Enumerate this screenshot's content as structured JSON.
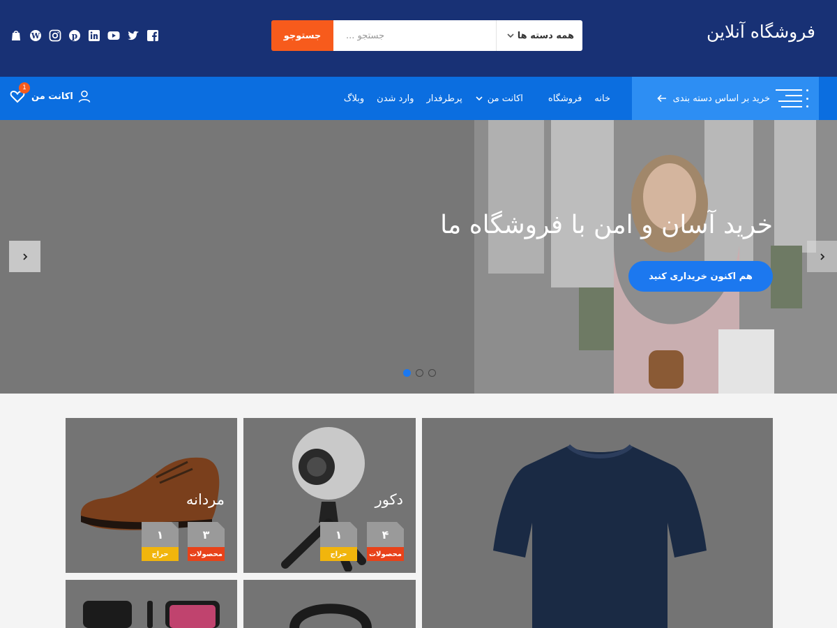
{
  "header": {
    "site_title": "فروشگاه آنلاین",
    "search": {
      "category_label": "همه دسته ها",
      "placeholder": "جستجو ...",
      "button_label": "جستوجو"
    },
    "social_icons": [
      "shopify-icon",
      "wordpress-icon",
      "instagram-icon",
      "pinterest-icon",
      "linkedin-icon",
      "youtube-icon",
      "twitter-icon",
      "facebook-icon"
    ]
  },
  "nav": {
    "category_toggle_label": "خرید بر اساس دسته بندی",
    "items": [
      {
        "label": "خانه"
      },
      {
        "label": "فروشگاه"
      },
      {
        "label": "اکانت من"
      },
      {
        "label": "پرطرفدار"
      },
      {
        "label": "وارد شدن"
      },
      {
        "label": "وبلاگ"
      }
    ],
    "account_label": "اکانت من",
    "wishlist_count": "1"
  },
  "hero": {
    "title": "خرید آسان و امن با فروشگاه ما",
    "button_label": "هم اکنون خریداری کنید",
    "slide_count": 3,
    "active_slide": 1
  },
  "categories": [
    {
      "title": "مردانه",
      "products_count": "۳",
      "products_label": "محصولات",
      "sale_count": "۱",
      "sale_label": "حراج"
    },
    {
      "title": "دکور",
      "products_count": "۴",
      "products_label": "محصولات",
      "sale_count": "۱",
      "sale_label": "حراج"
    }
  ],
  "colors": {
    "header_bg": "#183175",
    "nav_bg": "#0b6ee0",
    "accent_orange": "#f75b1c",
    "accent_blue": "#1c78ef"
  }
}
